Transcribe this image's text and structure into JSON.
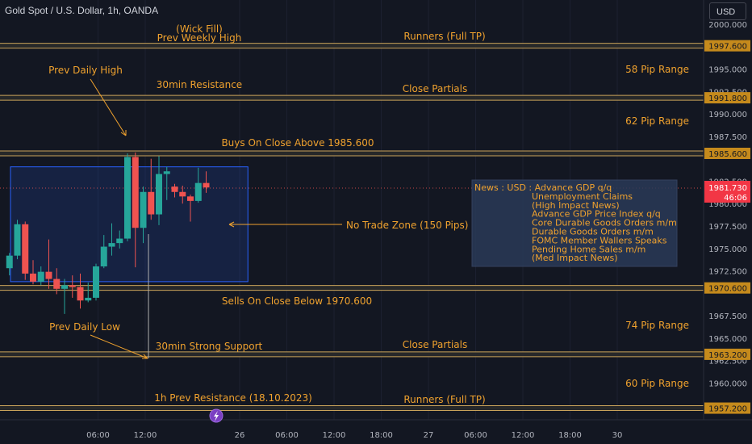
{
  "header": {
    "symbol_title": "Gold Spot / U.S. Dollar, 1h, OANDA",
    "currency_button": "USD"
  },
  "colors": {
    "background": "#131722",
    "level_line": "#c8a25a",
    "annotation": "#f0a22e",
    "candle_up": "#26a69a",
    "candle_down": "#ef5350",
    "zone_border": "#2962ff",
    "news_box": "#2a3a57"
  },
  "chart_data": {
    "type": "candlestick",
    "instrument": "XAU/USD",
    "timeframe": "1h",
    "y_axis": {
      "range": [
        1955.9,
        2002.7
      ],
      "ticks": [
        "2000.000",
        "1995.000",
        "1992.500",
        "1990.000",
        "1987.500",
        "1982.500",
        "1980.000",
        "1977.500",
        "1975.000",
        "1972.500",
        "1967.500",
        "1965.000",
        "1962.500",
        "1960.000",
        "1957.500"
      ],
      "current_price": "1981.730",
      "countdown": "46:06"
    },
    "x_axis": {
      "ticks": [
        {
          "label": "06:00",
          "hour": 6
        },
        {
          "label": "12:00",
          "hour": 12
        },
        {
          "label": "26",
          "hour": 24
        },
        {
          "label": "06:00",
          "hour": 30
        },
        {
          "label": "12:00",
          "hour": 36
        },
        {
          "label": "18:00",
          "hour": 42
        },
        {
          "label": "27",
          "hour": 48
        },
        {
          "label": "06:00",
          "hour": 54
        },
        {
          "label": "12:00",
          "hour": 60
        },
        {
          "label": "18:00",
          "hour": 66
        },
        {
          "label": "30",
          "hour": 72
        }
      ]
    },
    "candles": [
      {
        "hour": 1,
        "o": 1972.8,
        "h": 1974.5,
        "l": 1972.0,
        "c": 1974.2
      },
      {
        "hour": 2,
        "o": 1974.2,
        "h": 1978.2,
        "l": 1973.8,
        "c": 1977.7
      },
      {
        "hour": 3,
        "o": 1977.7,
        "h": 1978.0,
        "l": 1971.5,
        "c": 1972.2
      },
      {
        "hour": 4,
        "o": 1972.2,
        "h": 1973.7,
        "l": 1971.0,
        "c": 1971.3
      },
      {
        "hour": 5,
        "o": 1971.3,
        "h": 1973.0,
        "l": 1970.9,
        "c": 1972.4
      },
      {
        "hour": 6,
        "o": 1972.4,
        "h": 1976.0,
        "l": 1970.5,
        "c": 1971.6
      },
      {
        "hour": 7,
        "o": 1971.6,
        "h": 1972.8,
        "l": 1969.9,
        "c": 1970.5
      },
      {
        "hour": 8,
        "o": 1970.5,
        "h": 1971.6,
        "l": 1967.7,
        "c": 1970.9
      },
      {
        "hour": 9,
        "o": 1970.9,
        "h": 1972.0,
        "l": 1969.5,
        "c": 1970.7
      },
      {
        "hour": 10,
        "o": 1970.7,
        "h": 1972.2,
        "l": 1968.3,
        "c": 1969.2
      },
      {
        "hour": 11,
        "o": 1969.2,
        "h": 1971.2,
        "l": 1969.0,
        "c": 1969.5
      },
      {
        "hour": 12,
        "o": 1969.5,
        "h": 1973.3,
        "l": 1969.2,
        "c": 1973.0
      },
      {
        "hour": 13,
        "o": 1973.0,
        "h": 1976.5,
        "l": 1972.8,
        "c": 1975.2
      },
      {
        "hour": 14,
        "o": 1975.2,
        "h": 1977.8,
        "l": 1974.2,
        "c": 1975.6
      },
      {
        "hour": 15,
        "o": 1975.6,
        "h": 1977.0,
        "l": 1975.0,
        "c": 1976.1
      },
      {
        "hour": 16,
        "o": 1976.1,
        "h": 1985.6,
        "l": 1975.8,
        "c": 1985.2
      },
      {
        "hour": 17,
        "o": 1985.2,
        "h": 1985.7,
        "l": 1972.9,
        "c": 1977.3
      },
      {
        "hour": 18,
        "o": 1977.3,
        "h": 1981.9,
        "l": 1975.6,
        "c": 1981.3
      },
      {
        "hour": 19,
        "o": 1981.3,
        "h": 1985.0,
        "l": 1978.2,
        "c": 1978.8
      },
      {
        "hour": 20,
        "o": 1978.8,
        "h": 1985.3,
        "l": 1977.6,
        "c": 1983.3
      },
      {
        "hour": 21,
        "o": 1983.3,
        "h": 1984.1,
        "l": 1980.4,
        "c": 1983.6
      },
      {
        "hour": 22,
        "o": 1981.9,
        "h": 1982.2,
        "l": 1980.7,
        "c": 1981.3
      },
      {
        "hour": 23,
        "o": 1981.3,
        "h": 1982.0,
        "l": 1980.0,
        "c": 1980.8
      },
      {
        "hour": 24,
        "o": 1980.8,
        "h": 1981.0,
        "l": 1978.0,
        "c": 1980.3
      },
      {
        "hour": 25,
        "o": 1980.3,
        "h": 1984.0,
        "l": 1980.1,
        "c": 1982.3
      },
      {
        "hour": 26,
        "o": 1982.3,
        "h": 1983.6,
        "l": 1981.2,
        "c": 1981.8
      }
    ],
    "levels": [
      {
        "price": 1997.6,
        "label": "1997.600"
      },
      {
        "price": 1991.8,
        "label": "1991.800"
      },
      {
        "price": 1985.6,
        "label": "1985.600"
      },
      {
        "price": 1970.6,
        "label": "1970.600"
      },
      {
        "price": 1963.2,
        "label": "1963.200"
      },
      {
        "price": 1957.2,
        "label": "1957.200"
      }
    ],
    "zone": {
      "label": "No Trade Zone (150 Pips)",
      "from_hour": 0,
      "to_hour": 27,
      "top": 1984.1,
      "bottom": 1971.3
    },
    "annotations": {
      "wick_fill": "(Wick Fill)",
      "prev_weekly_high": "Prev Weekly High",
      "runners_top": "Runners (Full TP)",
      "prev_daily_high": "Prev Daily High",
      "resistance_30m": "30min Resistance",
      "close_partials_top": "Close Partials",
      "range_58": "58 Pip Range",
      "range_62": "62 Pip Range",
      "buys": "Buys On Close Above 1985.600",
      "sells": "Sells On Close Below 1970.600",
      "prev_daily_low": "Prev Daily Low",
      "strong_support_30m": "30min Strong Support",
      "close_partials_bottom": "Close Partials",
      "range_74": "74 Pip Range",
      "range_60": "60 Pip Range",
      "resistance_1h": "1h Prev Resistance (18.10.2023)",
      "runners_bottom": "Runners (Full TP)"
    },
    "news": {
      "lines": [
        "News : USD : Advance GDP q/q",
        "Unemployment Claims",
        "(High Impact News)",
        "Advance GDP Price Index q/q",
        "Core Durable Goods Orders m/m",
        "Durable Goods Orders m/m",
        "FOMC Member Wallers Speaks",
        "Pending Home Sales m/m",
        "(Med Impact News)"
      ]
    }
  }
}
